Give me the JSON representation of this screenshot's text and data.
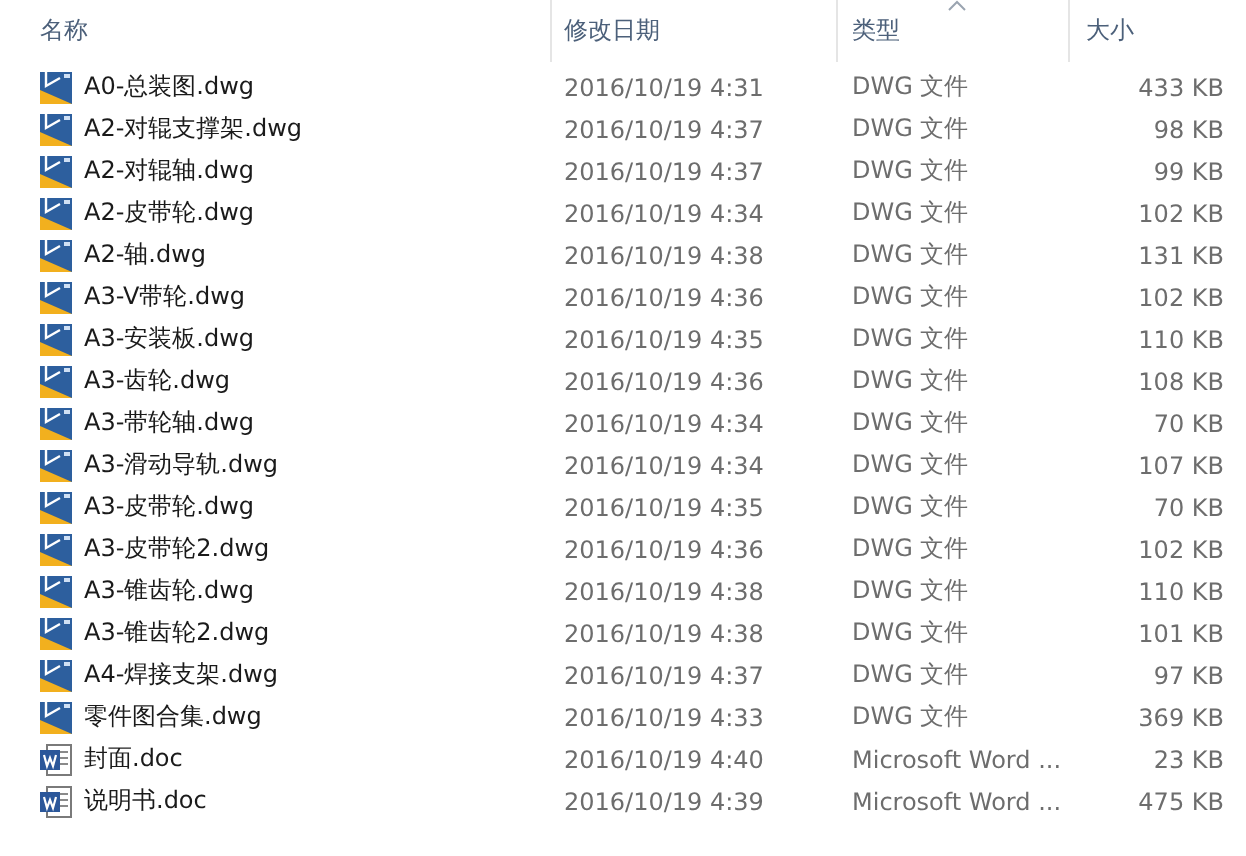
{
  "columns": [
    {
      "label": "名称",
      "sorted": false
    },
    {
      "label": "修改日期",
      "sorted": false
    },
    {
      "label": "类型",
      "sorted": true
    },
    {
      "label": "大小",
      "sorted": false
    }
  ],
  "files": [
    {
      "kind": "dwg",
      "name": "A0-总装图.dwg",
      "modified": "2016/10/19 4:31",
      "type": "DWG 文件",
      "size": "433 KB"
    },
    {
      "kind": "dwg",
      "name": "A2-对辊支撑架.dwg",
      "modified": "2016/10/19 4:37",
      "type": "DWG 文件",
      "size": "98 KB"
    },
    {
      "kind": "dwg",
      "name": "A2-对辊轴.dwg",
      "modified": "2016/10/19 4:37",
      "type": "DWG 文件",
      "size": "99 KB"
    },
    {
      "kind": "dwg",
      "name": "A2-皮带轮.dwg",
      "modified": "2016/10/19 4:34",
      "type": "DWG 文件",
      "size": "102 KB"
    },
    {
      "kind": "dwg",
      "name": "A2-轴.dwg",
      "modified": "2016/10/19 4:38",
      "type": "DWG 文件",
      "size": "131 KB"
    },
    {
      "kind": "dwg",
      "name": "A3-V带轮.dwg",
      "modified": "2016/10/19 4:36",
      "type": "DWG 文件",
      "size": "102 KB"
    },
    {
      "kind": "dwg",
      "name": "A3-安装板.dwg",
      "modified": "2016/10/19 4:35",
      "type": "DWG 文件",
      "size": "110 KB"
    },
    {
      "kind": "dwg",
      "name": "A3-齿轮.dwg",
      "modified": "2016/10/19 4:36",
      "type": "DWG 文件",
      "size": "108 KB"
    },
    {
      "kind": "dwg",
      "name": "A3-带轮轴.dwg",
      "modified": "2016/10/19 4:34",
      "type": "DWG 文件",
      "size": "70 KB"
    },
    {
      "kind": "dwg",
      "name": "A3-滑动导轨.dwg",
      "modified": "2016/10/19 4:34",
      "type": "DWG 文件",
      "size": "107 KB"
    },
    {
      "kind": "dwg",
      "name": "A3-皮带轮.dwg",
      "modified": "2016/10/19 4:35",
      "type": "DWG 文件",
      "size": "70 KB"
    },
    {
      "kind": "dwg",
      "name": "A3-皮带轮2.dwg",
      "modified": "2016/10/19 4:36",
      "type": "DWG 文件",
      "size": "102 KB"
    },
    {
      "kind": "dwg",
      "name": "A3-锥齿轮.dwg",
      "modified": "2016/10/19 4:38",
      "type": "DWG 文件",
      "size": "110 KB"
    },
    {
      "kind": "dwg",
      "name": "A3-锥齿轮2.dwg",
      "modified": "2016/10/19 4:38",
      "type": "DWG 文件",
      "size": "101 KB"
    },
    {
      "kind": "dwg",
      "name": "A4-焊接支架.dwg",
      "modified": "2016/10/19 4:37",
      "type": "DWG 文件",
      "size": "97 KB"
    },
    {
      "kind": "dwg",
      "name": "零件图合集.dwg",
      "modified": "2016/10/19 4:33",
      "type": "DWG 文件",
      "size": "369 KB"
    },
    {
      "kind": "doc",
      "name": "封面.doc",
      "modified": "2016/10/19 4:40",
      "type": "Microsoft Word ...",
      "size": "23 KB"
    },
    {
      "kind": "doc",
      "name": "说明书.doc",
      "modified": "2016/10/19 4:39",
      "type": "Microsoft Word ...",
      "size": "475 KB"
    }
  ]
}
